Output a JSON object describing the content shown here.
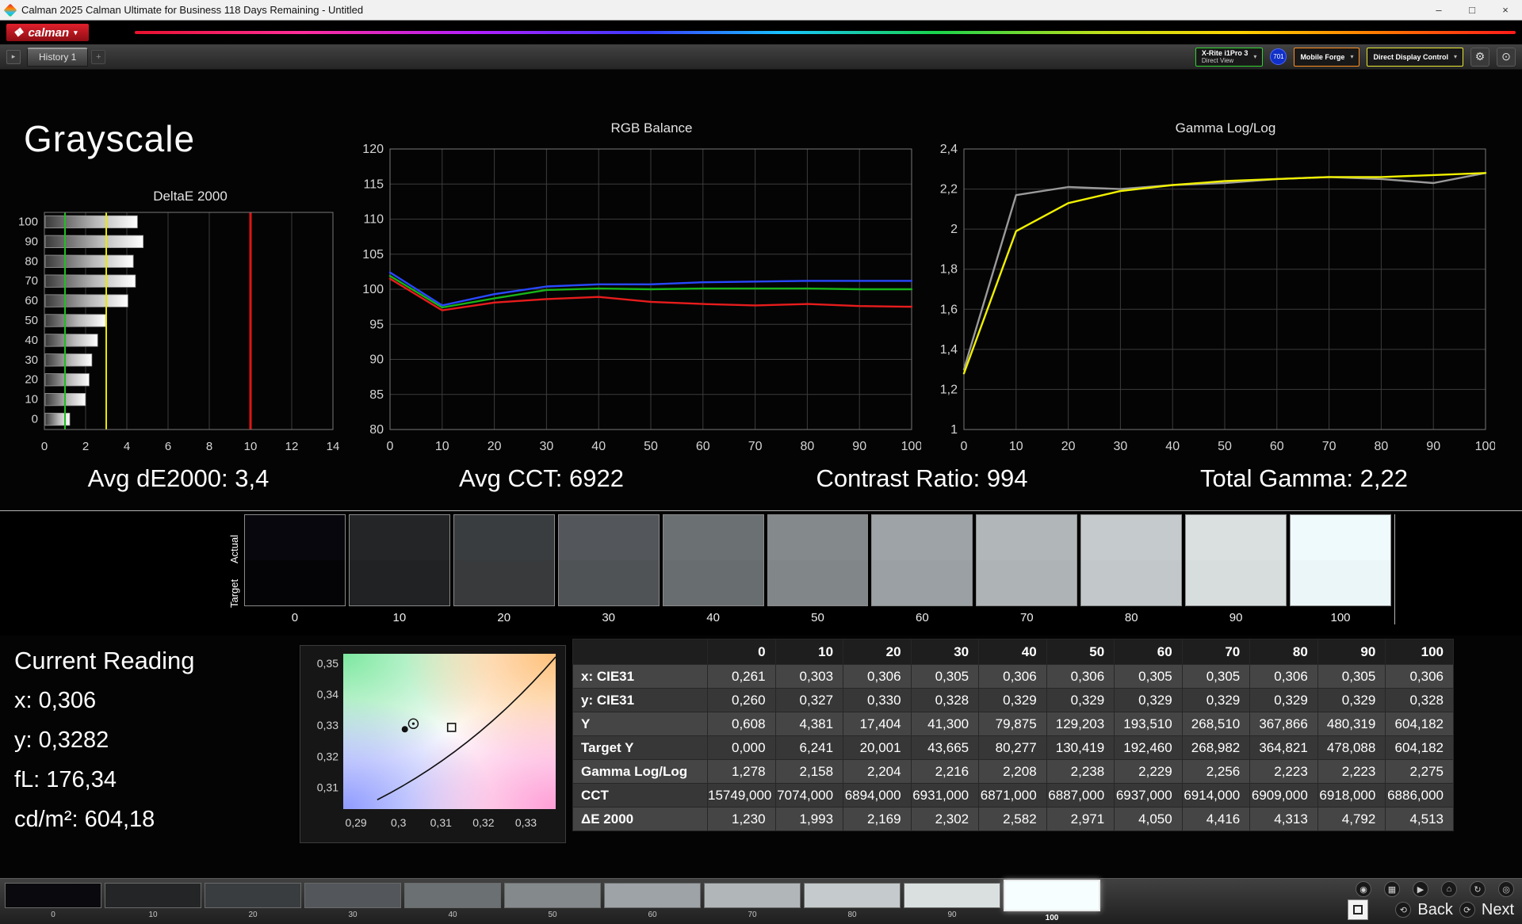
{
  "window": {
    "title": "Calman 2025 Calman Ultimate for Business 118 Days Remaining  - Untitled",
    "minimize": "–",
    "maximize": "□",
    "close": "×"
  },
  "brand": {
    "logo": "calman",
    "logo_mark": "❖",
    "caret": "▾"
  },
  "toolbar": {
    "collapse_glyph": "▸",
    "history_tab": "History 1",
    "tab_stub": "+",
    "meter_dropdown": {
      "line1": "X-Rite i1Pro 3",
      "line2": "Direct View",
      "accent": "#2fd42f",
      "caret": "▾"
    },
    "meter_badge": "701",
    "source_dropdown": {
      "label": "Mobile Forge",
      "accent": "#ff9020",
      "caret": "▾"
    },
    "display_dropdown": {
      "label": "Direct Display Control",
      "accent": "#e8e832",
      "caret": "▾"
    },
    "gear_glyph": "⚙",
    "power_glyph": "⊙"
  },
  "page": {
    "title": "Grayscale"
  },
  "stats": [
    {
      "label": "Avg dE2000: 3,4"
    },
    {
      "label": "Avg CCT: 6922"
    },
    {
      "label": "Contrast Ratio: 994"
    },
    {
      "label": "Total Gamma: 2,22"
    }
  ],
  "chart_data": [
    {
      "type": "bar",
      "title": "DeltaE 2000",
      "orientation": "horizontal",
      "categories": [
        100,
        90,
        80,
        70,
        60,
        50,
        40,
        30,
        20,
        10,
        0
      ],
      "values": [
        4.513,
        4.792,
        4.313,
        4.416,
        4.05,
        2.971,
        2.582,
        2.302,
        2.169,
        1.993,
        1.23
      ],
      "xlim": [
        0,
        14
      ],
      "x_ticks": [
        0,
        2,
        4,
        6,
        8,
        10,
        12,
        14
      ],
      "x_tick_labels": [
        "0",
        "2",
        "4",
        "6",
        "8",
        "10",
        "12",
        "14"
      ],
      "ref_lines": [
        {
          "name": "target-line",
          "value": 1,
          "color": "#1fbf1f",
          "width": 2
        },
        {
          "name": "warning-line",
          "value": 3,
          "color": "#e8e800",
          "width": 2
        },
        {
          "name": "limit-line",
          "value": 10,
          "color": "#e01414",
          "width": 3
        }
      ]
    },
    {
      "type": "line",
      "title": "RGB Balance",
      "x": [
        0,
        10,
        20,
        30,
        40,
        50,
        60,
        70,
        80,
        90,
        100
      ],
      "x_ticks": [
        0,
        10,
        20,
        30,
        40,
        50,
        60,
        70,
        80,
        90,
        100
      ],
      "x_tick_labels": [
        "0",
        "10",
        "20",
        "30",
        "40",
        "50",
        "60",
        "70",
        "80",
        "90",
        "100"
      ],
      "ylim": [
        80,
        120
      ],
      "y_ticks": [
        80,
        85,
        90,
        95,
        100,
        105,
        110,
        115,
        120
      ],
      "y_tick_labels": [
        "80",
        "85",
        "90",
        "95",
        "100",
        "105",
        "110",
        "115",
        "120"
      ],
      "series": [
        {
          "name": "Red",
          "color": "#e81c1c",
          "values": [
            101.5,
            97.0,
            98.1,
            98.6,
            98.9,
            98.2,
            97.9,
            97.7,
            97.9,
            97.6,
            97.5
          ]
        },
        {
          "name": "Green",
          "color": "#18b418",
          "values": [
            101.9,
            97.4,
            98.7,
            99.9,
            100.1,
            100.0,
            100.1,
            100.1,
            100.1,
            100.0,
            100.0
          ]
        },
        {
          "name": "Blue",
          "color": "#2848ff",
          "values": [
            102.4,
            97.7,
            99.3,
            100.4,
            100.7,
            100.7,
            101.0,
            101.1,
            101.2,
            101.2,
            101.2
          ]
        }
      ]
    },
    {
      "type": "line",
      "title": "Gamma Log/Log",
      "x": [
        0,
        10,
        20,
        30,
        40,
        50,
        60,
        70,
        80,
        90,
        100
      ],
      "x_ticks": [
        0,
        10,
        20,
        30,
        40,
        50,
        60,
        70,
        80,
        90,
        100
      ],
      "x_tick_labels": [
        "0",
        "10",
        "20",
        "30",
        "40",
        "50",
        "60",
        "70",
        "80",
        "90",
        "100"
      ],
      "ylim": [
        1,
        2.4
      ],
      "y_ticks": [
        1,
        1.2,
        1.4,
        1.6,
        1.8,
        2,
        2.2,
        2.4
      ],
      "y_tick_labels": [
        "1",
        "1,2",
        "1,4",
        "1,6",
        "1,8",
        "2",
        "2,2",
        "2,4"
      ],
      "series": [
        {
          "name": "Reference",
          "color": "#9a9a9a",
          "values": [
            1.3,
            2.17,
            2.21,
            2.2,
            2.22,
            2.23,
            2.25,
            2.26,
            2.25,
            2.23,
            2.28
          ]
        },
        {
          "name": "Gamma",
          "color": "#f0f000",
          "values": [
            1.28,
            1.99,
            2.13,
            2.19,
            2.22,
            2.24,
            2.25,
            2.26,
            2.26,
            2.27,
            2.28
          ]
        }
      ]
    },
    {
      "type": "scatter",
      "title": "CIE xy detail",
      "xlim": [
        0.287,
        0.337
      ],
      "ylim": [
        0.303,
        0.353
      ],
      "x_tick_values": [
        0.29,
        0.3,
        0.31,
        0.32,
        0.33
      ],
      "x_tick_labels": [
        "0,29",
        "0,3",
        "0,31",
        "0,32",
        "0,33"
      ],
      "y_tick_values": [
        0.31,
        0.32,
        0.33,
        0.34,
        0.35
      ],
      "y_tick_labels": [
        "0,31",
        "0,32",
        "0,33",
        "0,34",
        "0,35"
      ],
      "locus": [
        [
          0.295,
          0.306
        ],
        [
          0.318,
          0.322
        ],
        [
          0.337,
          0.352
        ]
      ],
      "points": [
        {
          "x": 0.3015,
          "y": 0.3287
        },
        {
          "x": 0.3035,
          "y": 0.3305
        }
      ],
      "target": {
        "x": 0.3125,
        "y": 0.3293
      }
    }
  ],
  "swatch_strip": {
    "row_labels": [
      "Actual",
      "Target"
    ],
    "labels": [
      "0",
      "10",
      "20",
      "30",
      "40",
      "50",
      "60",
      "70",
      "80",
      "90",
      "100"
    ],
    "actual": [
      "#07070d",
      "#232527",
      "#3a3d3f",
      "#53565a",
      "#6b7073",
      "#84898c",
      "#9da3a6",
      "#b1b7b9",
      "#c5cbcc",
      "#dae0e0",
      "#eefafb"
    ],
    "target": [
      "#040407",
      "#202224",
      "#383a3c",
      "#505356",
      "#686d70",
      "#818689",
      "#9aa0a3",
      "#aeb4b6",
      "#c2c8c9",
      "#d7dddd",
      "#eaf6f7"
    ]
  },
  "current_reading": {
    "title": "Current Reading",
    "lines": [
      "x: 0,306",
      "y: 0,3282",
      "fL: 176,34",
      "cd/m²: 604,18"
    ]
  },
  "table": {
    "columns": [
      "",
      "0",
      "10",
      "20",
      "30",
      "40",
      "50",
      "60",
      "70",
      "80",
      "90",
      "100"
    ],
    "rows": [
      {
        "label": "x: CIE31",
        "values": [
          "0,261",
          "0,303",
          "0,306",
          "0,305",
          "0,306",
          "0,306",
          "0,305",
          "0,305",
          "0,306",
          "0,305",
          "0,306"
        ]
      },
      {
        "label": "y: CIE31",
        "values": [
          "0,260",
          "0,327",
          "0,330",
          "0,328",
          "0,329",
          "0,329",
          "0,329",
          "0,329",
          "0,329",
          "0,329",
          "0,328"
        ]
      },
      {
        "label": "Y",
        "values": [
          "0,608",
          "4,381",
          "17,404",
          "41,300",
          "79,875",
          "129,203",
          "193,510",
          "268,510",
          "367,866",
          "480,319",
          "604,182"
        ]
      },
      {
        "label": "Target Y",
        "values": [
          "0,000",
          "6,241",
          "20,001",
          "43,665",
          "80,277",
          "130,419",
          "192,460",
          "268,982",
          "364,821",
          "478,088",
          "604,182"
        ]
      },
      {
        "label": "Gamma Log/Log",
        "values": [
          "1,278",
          "2,158",
          "2,204",
          "2,216",
          "2,208",
          "2,238",
          "2,229",
          "2,256",
          "2,223",
          "2,223",
          "2,275"
        ]
      },
      {
        "label": "CCT",
        "values": [
          "15749,000",
          "7074,000",
          "6894,000",
          "6931,000",
          "6871,000",
          "6887,000",
          "6937,000",
          "6914,000",
          "6909,000",
          "6918,000",
          "6886,000"
        ]
      },
      {
        "label": "ΔE 2000",
        "values": [
          "1,230",
          "1,993",
          "2,169",
          "2,302",
          "2,582",
          "2,971",
          "4,050",
          "4,416",
          "4,313",
          "4,792",
          "4,513"
        ]
      }
    ]
  },
  "pattern_bar": {
    "labels": [
      "0",
      "10",
      "20",
      "30",
      "40",
      "50",
      "60",
      "70",
      "80",
      "90",
      "100"
    ],
    "colors": [
      "#0a0a0e",
      "#232527",
      "#3a3d3f",
      "#53565a",
      "#6b7073",
      "#84898c",
      "#9da3a6",
      "#b1b7b9",
      "#c5cbcc",
      "#dae0e0",
      "#f6feff"
    ],
    "selected": "100"
  },
  "transport": {
    "icons": [
      {
        "name": "snapshot",
        "glyph": "◉"
      },
      {
        "name": "grid",
        "glyph": "▦"
      },
      {
        "name": "play",
        "glyph": "▶"
      },
      {
        "name": "home",
        "glyph": "⌂"
      },
      {
        "name": "refresh",
        "glyph": "↻"
      },
      {
        "name": "target",
        "glyph": "◎"
      }
    ],
    "back": {
      "label": "Back",
      "glyph": "⟲"
    },
    "next": {
      "label": "Next",
      "glyph": "⟳"
    }
  }
}
